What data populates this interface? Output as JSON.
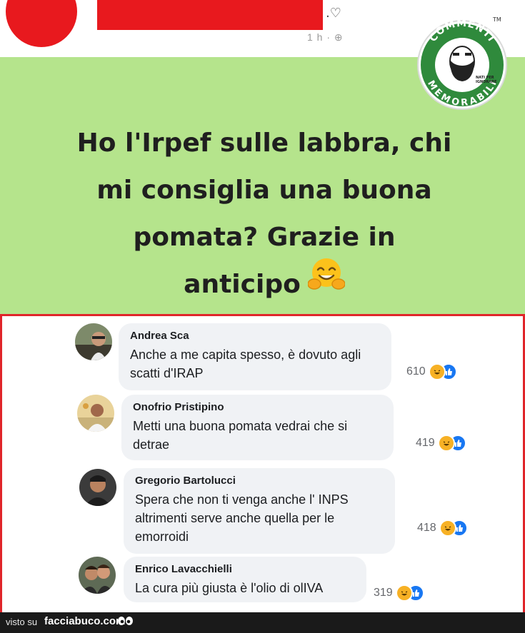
{
  "post": {
    "header_trail": ".♡",
    "time": "1 h · ⊕",
    "text": "Ho l'Irpef sulle labbra, chi\nmi consiglia una buona\npomata? Grazie in\nanticipo",
    "emoji": "hugging-face-icon"
  },
  "logo": {
    "top_text": "COMMENTI",
    "bottom_text": "MEMORABILI",
    "tagline_1": "NATI PER",
    "tagline_2": "IGNORARE",
    "tm": "TM",
    "colors": {
      "ring": "#2f8a3c",
      "inner": "#ffffff"
    }
  },
  "comments": [
    {
      "name": "Andrea Sca",
      "text": "Anche a me capita spesso, è dovuto agli scatti d'IRAP",
      "count": "610"
    },
    {
      "name": "Onofrio Pristipino",
      "text": "Metti una buona pomata vedrai che si detrae",
      "count": "419"
    },
    {
      "name": "Gregorio Bartolucci",
      "text": "Spera che non ti venga anche l' INPS altrimenti serve anche quella per le emorroidi",
      "count": "418"
    },
    {
      "name": "Enrico Lavacchielli",
      "text": "La cura più giusta è l'olio di olIVA",
      "count": "319"
    }
  ],
  "footer": {
    "visto": "visto su",
    "site": "facciabuco.com"
  },
  "colors": {
    "post_bg": "#b5e48c",
    "frame": "#e0252a",
    "redaction": "#e8191e",
    "bubble": "#f0f2f5"
  }
}
